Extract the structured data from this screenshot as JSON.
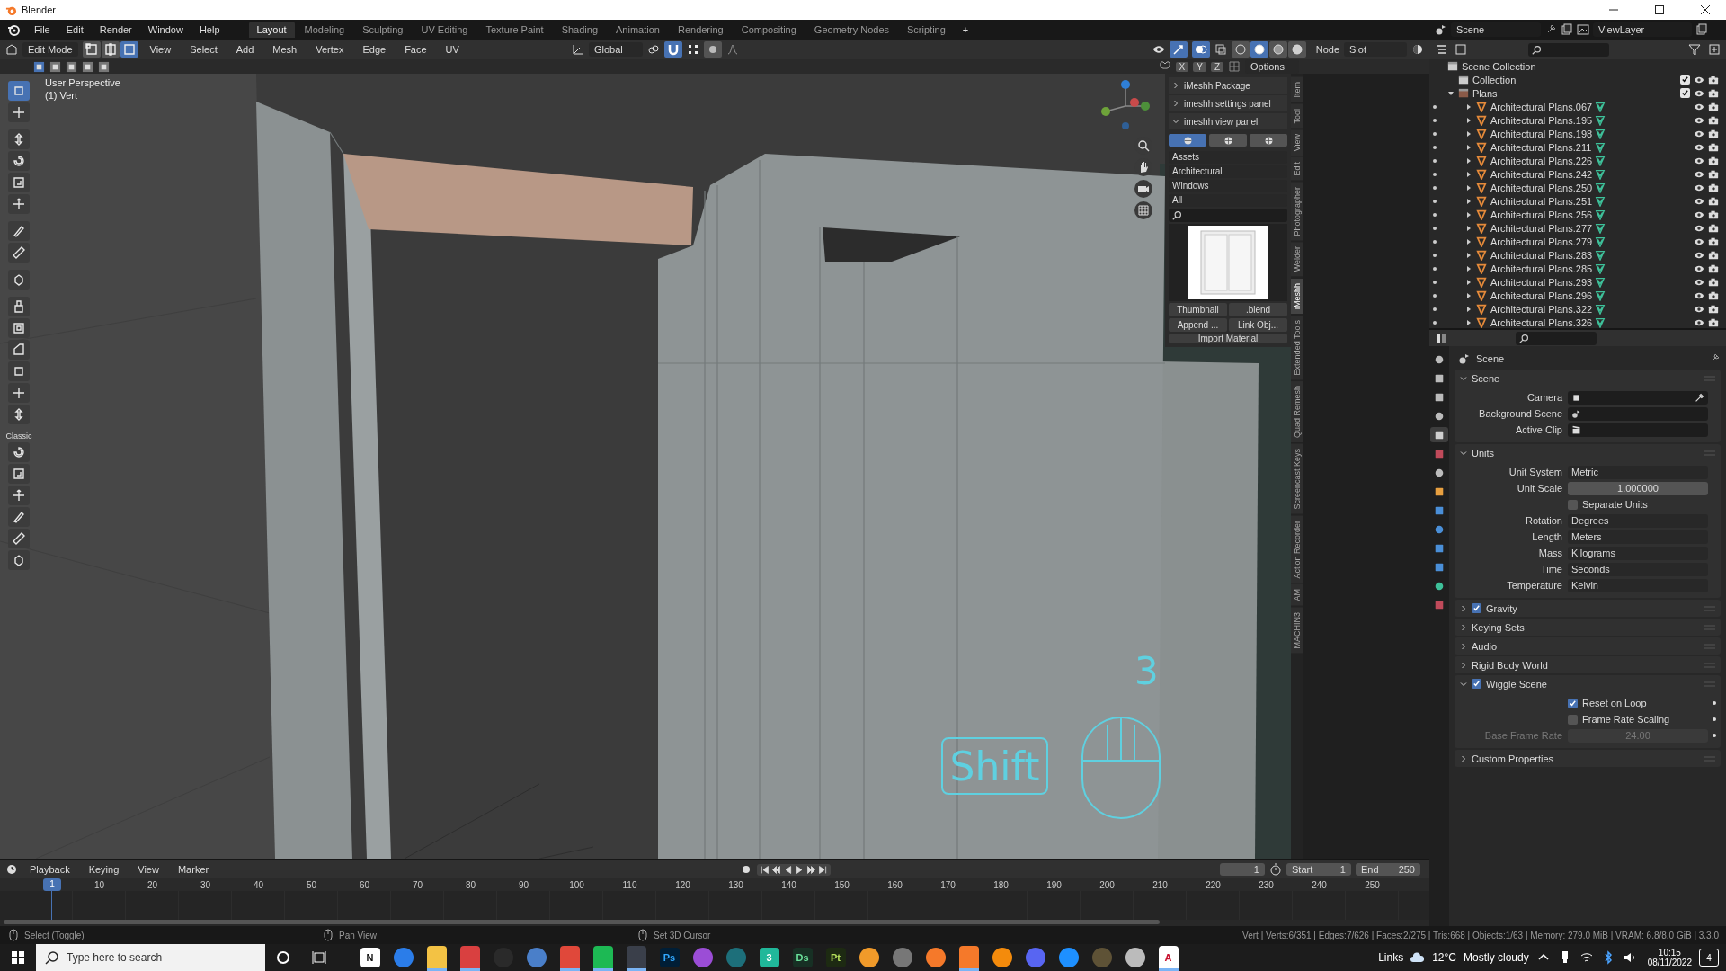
{
  "window": {
    "title": "Blender"
  },
  "menu": [
    "File",
    "Edit",
    "Render",
    "Window",
    "Help"
  ],
  "workspaces": [
    {
      "label": "Layout",
      "selected": true
    },
    {
      "label": "Modeling",
      "selected": false
    },
    {
      "label": "Sculpting",
      "selected": false
    },
    {
      "label": "UV Editing",
      "selected": false
    },
    {
      "label": "Texture Paint",
      "selected": false
    },
    {
      "label": "Shading",
      "selected": false
    },
    {
      "label": "Animation",
      "selected": false
    },
    {
      "label": "Rendering",
      "selected": false
    },
    {
      "label": "Compositing",
      "selected": false
    },
    {
      "label": "Geometry Nodes",
      "selected": false
    },
    {
      "label": "Scripting",
      "selected": false
    }
  ],
  "add_workspace": "+",
  "scene": "Scene",
  "view_layer": "ViewLayer",
  "viewport": {
    "mode": "Edit Mode",
    "select_modes": [
      {
        "kind": "vertex",
        "selected": false
      },
      {
        "kind": "edge",
        "selected": false
      },
      {
        "kind": "face",
        "selected": true
      }
    ],
    "menus": [
      "View",
      "Select",
      "Add",
      "Mesh",
      "Vertex",
      "Edge",
      "Face",
      "UV"
    ],
    "orientation": "Global",
    "snapping": true,
    "proportional": false,
    "shading": [
      {
        "kind": "wireframe",
        "selected": false
      },
      {
        "kind": "solid",
        "selected": true
      },
      {
        "kind": "material",
        "selected": false
      },
      {
        "kind": "rendered",
        "selected": false
      }
    ],
    "shading_mode": "Node",
    "slot": "Slot",
    "mirror_axes": [
      "X",
      "Y",
      "Z"
    ],
    "options": "Options",
    "view_name": "User Perspective",
    "selection_info": "(1) Vert",
    "tool_groups": [
      {
        "tools": [
          {
            "selected": true
          },
          {
            "selected": false
          }
        ]
      },
      {
        "tools": [
          {
            "selected": false
          },
          {
            "selected": false
          },
          {
            "selected": false
          },
          {
            "selected": false
          }
        ]
      },
      {
        "tools": [
          {
            "selected": false
          },
          {
            "selected": false
          }
        ]
      },
      {
        "tools": [
          {
            "selected": false
          }
        ]
      },
      {
        "tools": [
          {
            "selected": false
          },
          {
            "selected": false
          },
          {
            "selected": false
          },
          {
            "selected": false
          },
          {
            "selected": false
          },
          {
            "selected": false
          }
        ]
      },
      {
        "label": "Classic",
        "tools": [
          {
            "selected": false
          },
          {
            "selected": false
          },
          {
            "selected": false
          },
          {
            "selected": false
          },
          {
            "selected": false
          },
          {
            "selected": false
          }
        ]
      }
    ],
    "keys": {
      "count": "3",
      "key": "Shift"
    }
  },
  "sidebar": {
    "tabs": [
      {
        "label": "Item",
        "selected": false
      },
      {
        "label": "Tool",
        "selected": false
      },
      {
        "label": "View",
        "selected": false
      },
      {
        "label": "Edit",
        "selected": false
      },
      {
        "label": "Photographer",
        "selected": false
      },
      {
        "label": "Welder",
        "selected": false
      },
      {
        "label": "iMeshh",
        "selected": true
      },
      {
        "label": "Extended Tools",
        "selected": false
      },
      {
        "label": "Quad Remesh",
        "selected": false
      },
      {
        "label": "Screencast Keys",
        "selected": false
      },
      {
        "label": "Action Recorder",
        "selected": false
      },
      {
        "label": "AM",
        "selected": false
      },
      {
        "label": "MACHIN3",
        "selected": false
      }
    ],
    "panels": [
      {
        "title": "iMeshh Package",
        "expanded": false
      },
      {
        "title": "imeshh settings panel",
        "expanded": false
      },
      {
        "title": "imeshh view panel",
        "expanded": true
      }
    ],
    "view_tabs": [
      {
        "selected": true
      },
      {
        "selected": false
      },
      {
        "selected": false
      }
    ],
    "dropdowns": [
      "Assets",
      "Architectural",
      "Windows",
      "All"
    ],
    "thumbnail_button": "Thumbnail",
    "blend_button": ".blend",
    "append_button": "Append ...",
    "link_button": "Link Obj...",
    "import_button": "Import Material"
  },
  "outliner": {
    "root": "Scene Collection",
    "collections": [
      {
        "name": "Collection",
        "checked": true
      },
      {
        "name": "Plans",
        "checked": true,
        "children": [
          {
            "name": "Architectural Plans.067"
          },
          {
            "name": "Architectural Plans.195"
          },
          {
            "name": "Architectural Plans.198"
          },
          {
            "name": "Architectural Plans.211"
          },
          {
            "name": "Architectural Plans.226"
          },
          {
            "name": "Architectural Plans.242"
          },
          {
            "name": "Architectural Plans.250"
          },
          {
            "name": "Architectural Plans.251"
          },
          {
            "name": "Architectural Plans.256"
          },
          {
            "name": "Architectural Plans.277"
          },
          {
            "name": "Architectural Plans.279"
          },
          {
            "name": "Architectural Plans.283"
          },
          {
            "name": "Architectural Plans.285"
          },
          {
            "name": "Architectural Plans.293"
          },
          {
            "name": "Architectural Plans.296"
          },
          {
            "name": "Architectural Plans.322"
          },
          {
            "name": "Architectural Plans.326"
          }
        ]
      }
    ]
  },
  "properties": {
    "title": "Scene",
    "tabs": [
      {
        "selected": false
      },
      {
        "selected": false
      },
      {
        "selected": false
      },
      {
        "selected": false
      },
      {
        "selected": true
      },
      {
        "selected": false
      },
      {
        "selected": false
      },
      {
        "selected": false
      },
      {
        "selected": false
      },
      {
        "selected": false
      },
      {
        "selected": false
      },
      {
        "selected": false
      },
      {
        "selected": false
      },
      {
        "selected": false
      }
    ],
    "panels": [
      {
        "title": "Scene",
        "expanded": true,
        "rows": [
          {
            "kind": "camera",
            "label": "Camera"
          },
          {
            "kind": "scene",
            "label": "Background Scene"
          },
          {
            "kind": "clip",
            "label": "Active Clip"
          }
        ]
      },
      {
        "title": "Units",
        "expanded": true,
        "rows": [
          {
            "kind": "dropdown",
            "label": "Unit System",
            "value": "Metric"
          },
          {
            "kind": "number",
            "label": "Unit Scale",
            "value": "1.000000"
          },
          {
            "kind": "checkbox",
            "label": "Separate Units",
            "checked": false
          },
          {
            "kind": "dropdown",
            "label": "Rotation",
            "value": "Degrees"
          },
          {
            "kind": "dropdown",
            "label": "Length",
            "value": "Meters"
          },
          {
            "kind": "dropdown",
            "label": "Mass",
            "value": "Kilograms"
          },
          {
            "kind": "dropdown",
            "label": "Time",
            "value": "Seconds"
          },
          {
            "kind": "dropdown",
            "label": "Temperature",
            "value": "Kelvin"
          }
        ]
      },
      {
        "title": "Gravity",
        "expanded": false,
        "checked": true
      },
      {
        "title": "Keying Sets",
        "expanded": false
      },
      {
        "title": "Audio",
        "expanded": false
      },
      {
        "title": "Rigid Body World",
        "expanded": false
      },
      {
        "title": "Wiggle Scene",
        "expanded": true,
        "checked": true,
        "rows": [
          {
            "kind": "checkbox",
            "label": "Reset on Loop",
            "checked": true,
            "keyframe": true,
            "disabled": false
          },
          {
            "kind": "checkbox",
            "label": "Frame Rate Scaling",
            "checked": false,
            "keyframe": true,
            "disabled": false
          },
          {
            "kind": "number",
            "label": "Base Frame Rate",
            "value": "24.00",
            "keyframe": true,
            "disabled": true
          }
        ]
      },
      {
        "title": "Custom Properties",
        "expanded": false
      }
    ]
  },
  "timeline": {
    "menus": [
      "Playback",
      "Keying",
      "View",
      "Marker"
    ],
    "current_frame": "1",
    "start_label": "Start",
    "start": "1",
    "end_label": "End",
    "end": "250",
    "playhead": "1",
    "ticks": [
      "10",
      "20",
      "30",
      "40",
      "50",
      "60",
      "70",
      "80",
      "90",
      "100",
      "110",
      "120",
      "130",
      "140",
      "150",
      "160",
      "170",
      "180",
      "190",
      "200",
      "210",
      "220",
      "230",
      "240",
      "250"
    ]
  },
  "status_bar": {
    "hints": [
      "Select (Toggle)",
      "Pan View",
      "Set 3D Cursor"
    ],
    "stats": "Vert | Verts:6/351 | Edges:7/626 | Faces:2/275 | Tris:668 | Objects:1/63 | Memory: 279.0 MiB | VRAM: 6.8/8.0 GiB | 3.3.0"
  },
  "taskbar": {
    "search_placeholder": "Type here to search",
    "apps": [
      {
        "kind": "notion",
        "label": "N",
        "running": false
      },
      {
        "kind": "store",
        "running": false
      },
      {
        "kind": "folder",
        "running": true
      },
      {
        "kind": "snip",
        "running": true
      },
      {
        "kind": "obs",
        "running": false
      },
      {
        "kind": "calculator",
        "running": false
      },
      {
        "kind": "chrome",
        "running": true
      },
      {
        "kind": "spotify",
        "running": true
      },
      {
        "kind": "davinci",
        "running": true
      },
      {
        "kind": "photoshop",
        "label": "Ps",
        "running": false
      },
      {
        "kind": "affinity",
        "running": false
      },
      {
        "kind": "cube",
        "running": false
      },
      {
        "kind": "substance",
        "label": "3",
        "running": false
      },
      {
        "kind": "dimension",
        "label": "Ds",
        "running": false
      },
      {
        "kind": "painter",
        "label": "Pt",
        "running": false
      },
      {
        "kind": "box",
        "running": false
      },
      {
        "kind": "aperture",
        "running": false
      },
      {
        "kind": "blender",
        "running": false
      },
      {
        "kind": "blender",
        "running": true
      },
      {
        "kind": "vlc",
        "running": false
      },
      {
        "kind": "discord",
        "running": false
      },
      {
        "kind": "c",
        "running": false
      },
      {
        "kind": "block",
        "running": false
      },
      {
        "kind": "sync",
        "running": false
      },
      {
        "kind": "autocad",
        "label": "A",
        "running": true
      }
    ],
    "links": "Links",
    "temperature": "12°C",
    "weather": "Mostly cloudy",
    "time": "10:15",
    "date": "08/11/2022",
    "notifications": "4"
  }
}
